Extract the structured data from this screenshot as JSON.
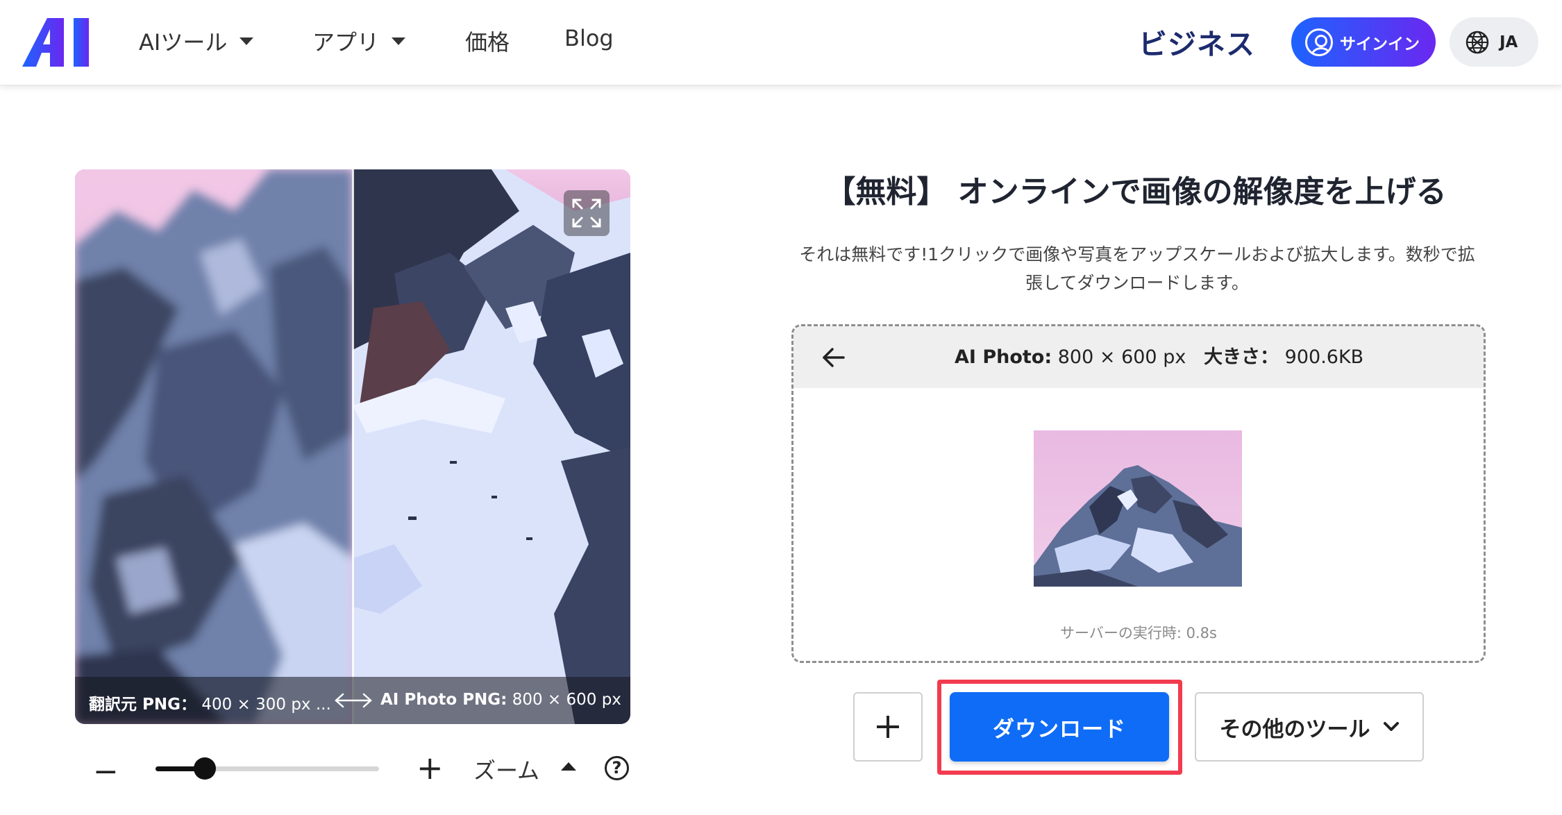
{
  "header": {
    "logo_text": "AI",
    "nav": [
      {
        "label": "AIツール",
        "has_dropdown": true
      },
      {
        "label": "アプリ",
        "has_dropdown": true
      },
      {
        "label": "価格",
        "has_dropdown": false
      },
      {
        "label": "Blog",
        "has_dropdown": false
      }
    ],
    "business_label": "ビジネス",
    "signin_label": "サインイン",
    "language_label": "JA"
  },
  "viewer": {
    "original_label": "翻訳元 PNG：",
    "original_size": "400 × 300 px ...",
    "result_label": "AI Photo PNG:",
    "result_size": "800 × 600 px",
    "result_ellipsis": "...",
    "expand_icon": "expand-icon",
    "compare_icon": "left-right-arrow-icon"
  },
  "zoom": {
    "minus_label": "−",
    "plus_label": "+",
    "label": "ズーム",
    "level": 0.22,
    "help_label": "?"
  },
  "panel": {
    "title": "【無料】 オンラインで画像の解像度を上げる",
    "description": "それは無料です!1クリックで画像や写真をアップスケールおよび拡大します。数秒で拡張してダウンロードします。",
    "result": {
      "name_label": "AI Photo:",
      "dimensions": "800 × 600 px",
      "size_label": "大きさ：",
      "size_value": "900.6KB",
      "server_time": "サーバーの実行時: 0.8s"
    }
  },
  "actions": {
    "add_label": "+",
    "download_label": "ダウンロード",
    "other_tools_label": "その他のツール"
  },
  "colors": {
    "primary_blue": "#0f6cf6",
    "signin_gradient_start": "#1e63ff",
    "signin_gradient_end": "#6a28f0",
    "highlight_red": "#f23b4e",
    "brand_navy": "#1d2b6e"
  }
}
